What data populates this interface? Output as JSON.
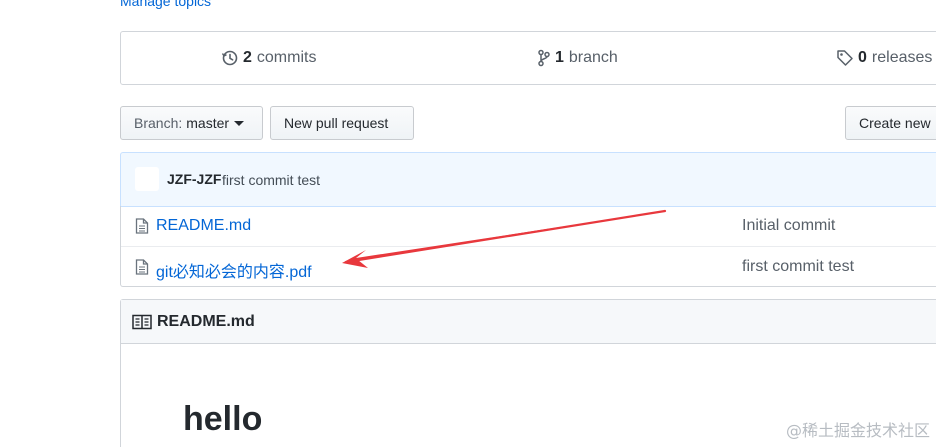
{
  "topics": {
    "manage_label": "Manage topics"
  },
  "summary": {
    "commits": {
      "count": "2",
      "label": "commits",
      "icon": "history-icon"
    },
    "branches": {
      "count": "1",
      "label": "branch",
      "icon": "git-branch-icon"
    },
    "releases": {
      "count": "0",
      "label": "releases",
      "icon": "tag-icon"
    }
  },
  "toolbar": {
    "branch_prefix": "Branch:",
    "branch_name": "master",
    "new_pr_label": "New pull request",
    "create_new_label": "Create new"
  },
  "latest_commit": {
    "author": "JZF-JZF",
    "message": "first commit test"
  },
  "files": [
    {
      "name": "README.md",
      "commit_message": "Initial commit",
      "icon": "file-icon"
    },
    {
      "name": "git必知必会的内容.pdf",
      "commit_message": "first commit test",
      "icon": "file-icon"
    }
  ],
  "readme": {
    "title": "README.md",
    "heading": "hello",
    "icon": "book-icon"
  },
  "annotation": {
    "color": "#e8383d"
  },
  "watermark": "@稀土掘金技术社区"
}
